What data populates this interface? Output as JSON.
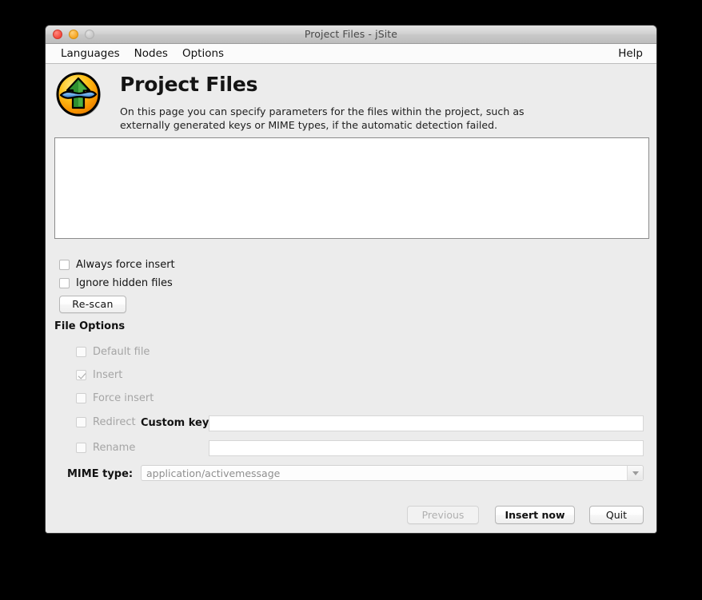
{
  "window": {
    "title": "Project Files - jSite",
    "controls": {
      "close": "close-button",
      "minimize": "minimize-button",
      "zoom": "zoom-button"
    }
  },
  "menubar": {
    "items": [
      {
        "label": "Languages"
      },
      {
        "label": "Nodes"
      },
      {
        "label": "Options"
      }
    ],
    "right_items": [
      {
        "label": "Help"
      }
    ]
  },
  "header": {
    "icon": "jsite-freenet-icon",
    "title": "Project Files",
    "description_line1": "On this page you can specify parameters for the files within the project, such as",
    "description_line2": "externally generated keys or MIME types, if the automatic detection failed."
  },
  "file_list": {
    "name": "project-file-list",
    "items": [],
    "empty": true
  },
  "scan_options": {
    "always_force_insert": {
      "label": "Always force insert",
      "checked": false,
      "enabled": true
    },
    "ignore_hidden_files": {
      "label": "Ignore hidden files",
      "checked": false,
      "enabled": true
    },
    "rescan_button": {
      "label": "Re-scan",
      "enabled": true
    }
  },
  "file_options": {
    "section_title": "File Options",
    "default_file": {
      "label": "Default file",
      "checked": false,
      "enabled": false
    },
    "insert": {
      "label": "Insert",
      "checked": true,
      "enabled": false
    },
    "force_insert": {
      "label": "Force insert",
      "checked": false,
      "enabled": false
    },
    "redirect": {
      "label": "Redirect",
      "checked": false,
      "enabled": false
    },
    "rename": {
      "label": "Rename",
      "checked": false,
      "enabled": false
    },
    "custom_key": {
      "label": "Custom key:",
      "value": "",
      "placeholder": ""
    },
    "rename_field": {
      "value": "",
      "placeholder": ""
    },
    "mime_type": {
      "label": "MIME type:",
      "value": "application/activemessage",
      "arrow": "chevron-down-icon"
    }
  },
  "footer": {
    "previous": {
      "label": "Previous",
      "enabled": false,
      "default": false
    },
    "insert_now": {
      "label": "Insert now",
      "enabled": true,
      "default": true
    },
    "quit": {
      "label": "Quit",
      "enabled": true,
      "default": false
    }
  },
  "colors": {
    "window_background": "#ececec",
    "titlebar_top": "#e4e4e4",
    "titlebar_bottom": "#bdbdbd",
    "menubar": "#fbfbfb",
    "close_button": "#f4483c",
    "minimize_button": "#f6a623",
    "zoom_button": "#c6c6c6",
    "field_background": "#ffffff",
    "disabled_text": "#a5a5a5",
    "icon_orange": "#f7a600",
    "icon_yellow": "#ffe44d",
    "icon_green": "#2e8b2e",
    "icon_blue": "#4a8fd4",
    "desktop": "#000000"
  }
}
